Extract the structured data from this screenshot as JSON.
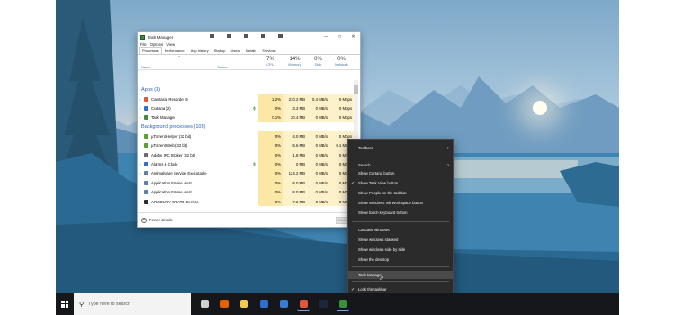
{
  "task_manager": {
    "title": "Task Manager",
    "menu": [
      "File",
      "Options",
      "View"
    ],
    "tabs": [
      "Processes",
      "Performance",
      "App history",
      "Startup",
      "Users",
      "Details",
      "Services"
    ],
    "active_tab": "Processes",
    "columns": {
      "name": "Name",
      "status": "Status",
      "cpu": {
        "pct": "7%",
        "label": "CPU"
      },
      "memory": {
        "pct": "14%",
        "label": "Memory"
      },
      "disk": {
        "pct": "0%",
        "label": "Disk"
      },
      "network": {
        "pct": "0%",
        "label": "Network"
      }
    },
    "apps_header": "Apps (3)",
    "apps": [
      {
        "name": "Camtasia Recorder 9",
        "cpu": "2.2%",
        "memory": "210.2 MB",
        "disk": "0.4 MB/s",
        "network": "0 Mbps",
        "icon_color": "#e2573a",
        "expandable": true,
        "status_icon": ""
      },
      {
        "name": "Cortana (2)",
        "cpu": "0%",
        "memory": "3.3 MB",
        "disk": "0 MB/s",
        "network": "0 Mbps",
        "icon_color": "#2f6fd1",
        "expandable": true,
        "status_icon": "pin-icon"
      },
      {
        "name": "Task Manager",
        "cpu": "0.1%",
        "memory": "20.4 MB",
        "disk": "0 MB/s",
        "network": "0 Mbps",
        "icon_color": "#3b8f3b",
        "expandable": true,
        "status_icon": ""
      }
    ],
    "background_header": "Background processes (103)",
    "background": [
      {
        "name": "μTorrent Helper (32 bit)",
        "cpu": "0%",
        "memory": "4.0 MB",
        "disk": "0 MB/s",
        "network": "0 Mbps",
        "icon_color": "#5aa02c",
        "expandable": false,
        "status_icon": ""
      },
      {
        "name": "μTorrent Web (32 bit)",
        "cpu": "0%",
        "memory": "5.6 MB",
        "disk": "0 MB/s",
        "network": "0.1 Mbps",
        "icon_color": "#5aa02c",
        "expandable": false,
        "status_icon": ""
      },
      {
        "name": "Adobe IPC Broker (32 bit)",
        "cpu": "0%",
        "memory": "1.8 MB",
        "disk": "0 MB/s",
        "network": "0 Mbps",
        "icon_color": "#6b6b6b",
        "expandable": false,
        "status_icon": ""
      },
      {
        "name": "Alarms & Clock",
        "cpu": "0%",
        "memory": "0 MB",
        "disk": "0 MB/s",
        "network": "0 Mbps",
        "icon_color": "#2f6fd1",
        "expandable": true,
        "status_icon": "pin-icon"
      },
      {
        "name": "Antimalware Service Executable",
        "cpu": "0%",
        "memory": "124.2 MB",
        "disk": "0 MB/s",
        "network": "0 Mbps",
        "icon_color": "#5a7fa8",
        "expandable": true,
        "status_icon": ""
      },
      {
        "name": "Application Frame Host",
        "cpu": "0%",
        "memory": "8.0 MB",
        "disk": "0 MB/s",
        "network": "0 Mbps",
        "icon_color": "#5a7fa8",
        "expandable": false,
        "status_icon": ""
      },
      {
        "name": "Application Frame Host",
        "cpu": "0%",
        "memory": "8.0 MB",
        "disk": "0 MB/s",
        "network": "0 Mbps",
        "icon_color": "#5a7fa8",
        "expandable": false,
        "status_icon": ""
      },
      {
        "name": "ARMOURY CRATE Service",
        "cpu": "0%",
        "memory": "7.2 MB",
        "disk": "0 MB/s",
        "network": "0 Mbps",
        "icon_color": "#2b2b2b",
        "expandable": true,
        "status_icon": ""
      }
    ],
    "fewer_details": "Fewer details",
    "end_task": "End task"
  },
  "context_menu": {
    "items": [
      {
        "label": "Toolbars",
        "submenu": true,
        "checked": false,
        "highlight": false
      },
      {
        "label": "Search",
        "submenu": true,
        "checked": false,
        "highlight": false
      },
      {
        "label": "Show Cortana button",
        "submenu": false,
        "checked": false,
        "highlight": false
      },
      {
        "label": "Show Task View button",
        "submenu": false,
        "checked": true,
        "highlight": false
      },
      {
        "label": "Show People on the taskbar",
        "submenu": false,
        "checked": false,
        "highlight": false
      },
      {
        "label": "Show Windows Ink Workspace button",
        "submenu": false,
        "checked": false,
        "highlight": false
      },
      {
        "label": "Show touch keyboard button",
        "submenu": false,
        "checked": false,
        "highlight": false
      },
      {
        "label": "Cascade windows",
        "submenu": false,
        "checked": false,
        "highlight": false
      },
      {
        "label": "Show windows stacked",
        "submenu": false,
        "checked": false,
        "highlight": false
      },
      {
        "label": "Show windows side by side",
        "submenu": false,
        "checked": false,
        "highlight": false
      },
      {
        "label": "Show the desktop",
        "submenu": false,
        "checked": false,
        "highlight": false
      },
      {
        "label": "Task Manager",
        "submenu": false,
        "checked": false,
        "highlight": true
      },
      {
        "label": "Lock the taskbar",
        "submenu": false,
        "checked": true,
        "highlight": false
      },
      {
        "label": "Taskbar settings",
        "submenu": false,
        "checked": false,
        "highlight": false
      }
    ]
  },
  "taskbar": {
    "search_placeholder": "Type here to search",
    "apps": [
      {
        "name": "task-view-icon",
        "color": "#d0d0d0",
        "running": false
      },
      {
        "name": "firefox-icon",
        "color": "#e66000",
        "running": false
      },
      {
        "name": "file-explorer-icon",
        "color": "#f2c94c",
        "running": false
      },
      {
        "name": "mail-icon",
        "color": "#2f6fd1",
        "running": false
      },
      {
        "name": "store-icon",
        "color": "#3a7bd5",
        "running": false
      },
      {
        "name": "camtasia-icon",
        "color": "#e2573a",
        "running": true
      },
      {
        "name": "steam-icon",
        "color": "#1b2838",
        "running": false
      },
      {
        "name": "task-manager-icon",
        "color": "#3b8f3b",
        "running": true
      }
    ]
  }
}
